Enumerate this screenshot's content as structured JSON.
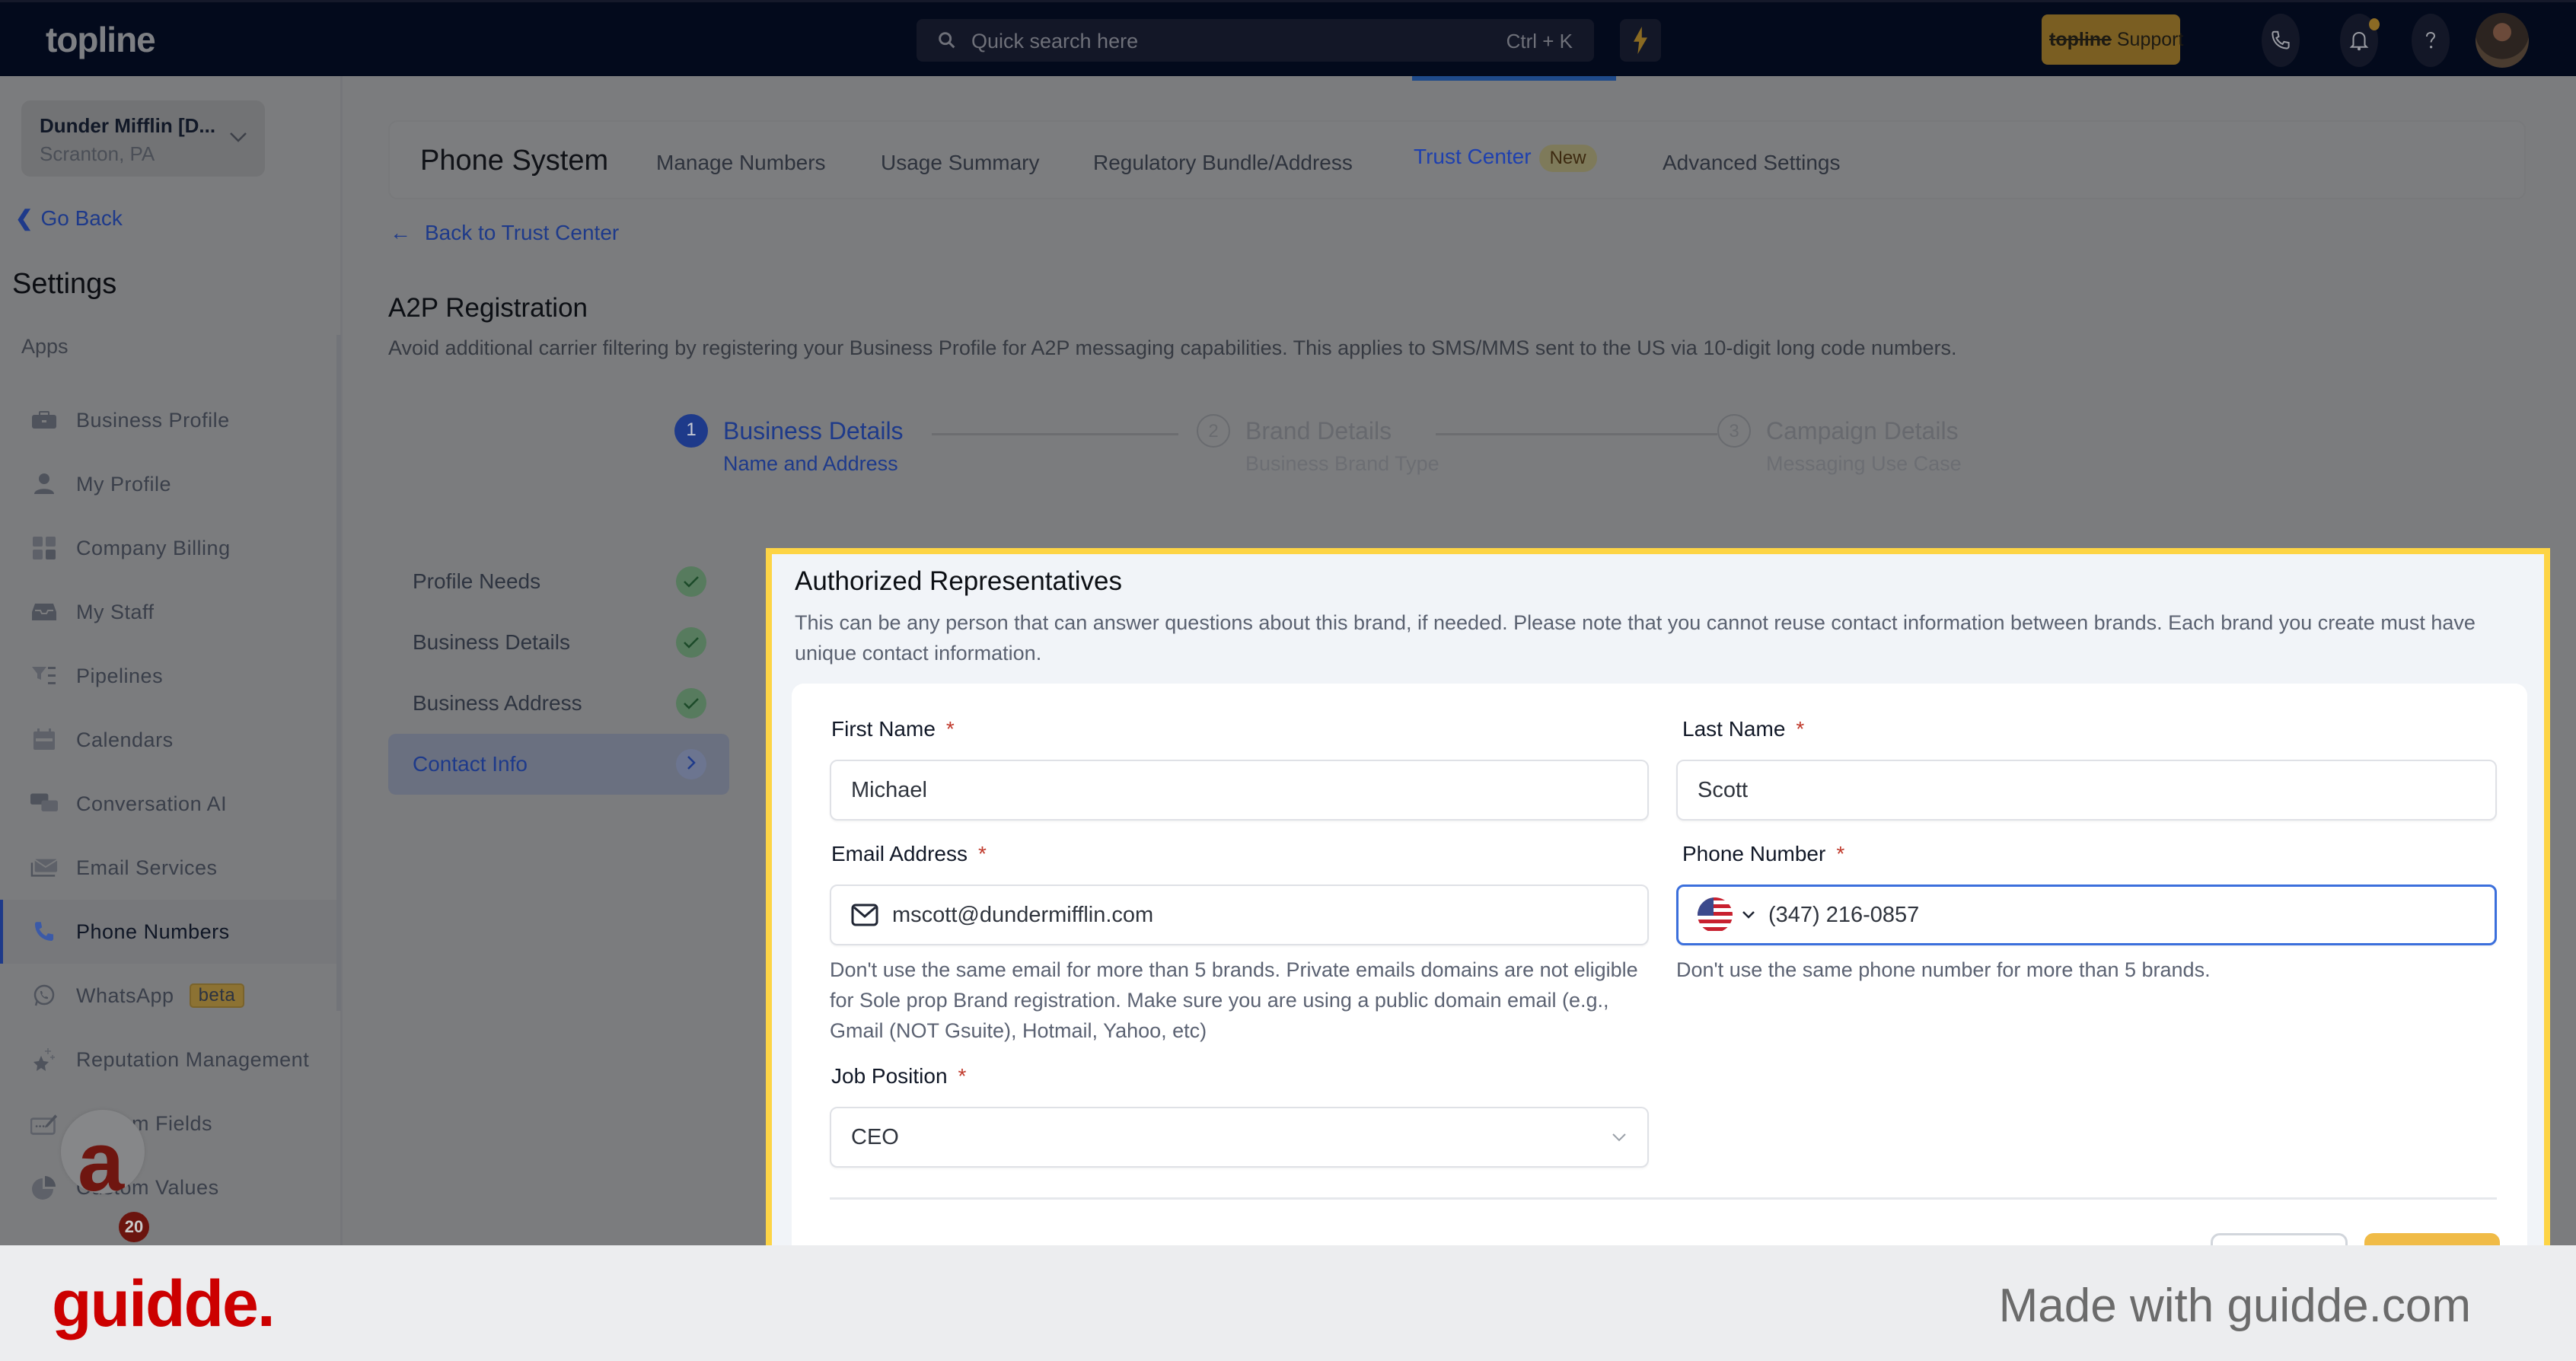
{
  "header": {
    "logo": "topline",
    "search_placeholder": "Quick search here",
    "search_shortcut": "Ctrl + K",
    "support_brand": "topline",
    "support_label": " Support"
  },
  "sidebar": {
    "location_name": "Dunder Mifflin [D...",
    "location_sub": "Scranton, PA",
    "go_back": "Go Back",
    "settings_title": "Settings",
    "apps_label": "Apps",
    "items": [
      {
        "label": "Business Profile",
        "icon": "briefcase-icon"
      },
      {
        "label": "My Profile",
        "icon": "user-icon"
      },
      {
        "label": "Company Billing",
        "icon": "calculator-icon"
      },
      {
        "label": "My Staff",
        "icon": "inbox-icon"
      },
      {
        "label": "Pipelines",
        "icon": "funnel-icon"
      },
      {
        "label": "Calendars",
        "icon": "calendar-icon"
      },
      {
        "label": "Conversation AI",
        "icon": "chat-bubbles-icon"
      },
      {
        "label": "Email Services",
        "icon": "envelope-icon"
      },
      {
        "label": "Phone Numbers",
        "icon": "phone-icon",
        "active": true
      },
      {
        "label": "WhatsApp",
        "icon": "whatsapp-icon",
        "badge": "beta"
      },
      {
        "label": "Reputation Management",
        "icon": "sparkle-star-icon"
      },
      {
        "label": "Custom Fields",
        "icon": "edit-field-icon"
      },
      {
        "label": "Custom Values",
        "icon": "pie-chart-icon"
      }
    ],
    "fab_badge": "20"
  },
  "tabs": {
    "title": "Phone System",
    "items": [
      {
        "label": "Manage Numbers"
      },
      {
        "label": "Usage Summary"
      },
      {
        "label": "Regulatory Bundle/Address"
      },
      {
        "label": "Trust Center",
        "badge": "New",
        "active": true
      },
      {
        "label": "Advanced Settings"
      }
    ]
  },
  "page": {
    "back_link": "Back to Trust Center",
    "title": "A2P Registration",
    "description": "Avoid additional carrier filtering by registering your Business Profile for A2P messaging capabilities. This applies to SMS/MMS sent to the US via 10-digit long code numbers."
  },
  "stepper": [
    {
      "number": "1",
      "title": "Business Details",
      "subtitle": "Name and Address",
      "state": "active"
    },
    {
      "number": "2",
      "title": "Brand Details",
      "subtitle": "Business Brand Type",
      "state": "pending"
    },
    {
      "number": "3",
      "title": "Campaign Details",
      "subtitle": "Messaging Use Case",
      "state": "pending"
    }
  ],
  "subnav": [
    {
      "label": "Profile Needs",
      "status": "complete"
    },
    {
      "label": "Business Details",
      "status": "complete"
    },
    {
      "label": "Business Address",
      "status": "complete"
    },
    {
      "label": "Contact Info",
      "status": "current"
    }
  ],
  "form": {
    "section_title": "Authorized Representatives",
    "section_description": "This can be any person that can answer questions about this brand, if needed. Please note that you cannot reuse contact information between brands. Each brand you create must have unique contact information.",
    "required_mark": "*",
    "first_name": {
      "label": "First Name",
      "value": "Michael"
    },
    "last_name": {
      "label": "Last Name",
      "value": "Scott"
    },
    "email": {
      "label": "Email Address",
      "value": "mscott@dundermifflin.com",
      "help": "Don't use the same email for more than 5 brands. Private emails domains are not eligible for Sole prop Brand registration. Make sure you are using a public domain email (e.g., Gmail (NOT Gsuite), Hotmail, Yahoo, etc)"
    },
    "phone": {
      "label": "Phone Number",
      "country": "US",
      "value": "(347) 216-0857",
      "help": "Don't use the same phone number for more than 5 brands."
    },
    "job_position": {
      "label": "Job Position",
      "value": "CEO"
    }
  },
  "colors": {
    "accent": "#1e40af",
    "highlight": "#fdd445",
    "primary_button": "#f0bb47",
    "required": "#c0392b"
  },
  "footer": {
    "logo": "guidde.",
    "made_with": "Made with guidde.com"
  }
}
